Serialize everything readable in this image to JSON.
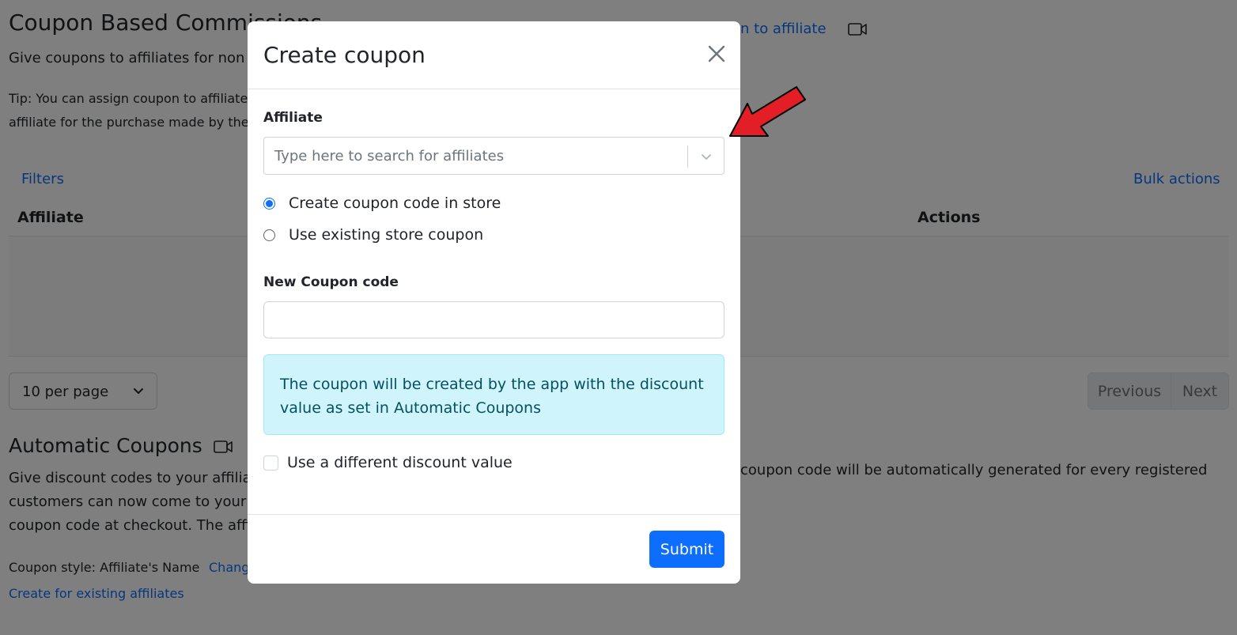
{
  "page": {
    "title": "Coupon Based Commissions",
    "subtitle": "Give coupons to affiliates for non r",
    "assign_link": "n to affiliate",
    "tip_line1": "Tip: You can assign coupon to affiliates.",
    "tip_line2": "affiliate for the purchase made by the c",
    "filters": "Filters",
    "bulk_actions": "Bulk actions",
    "columns": {
      "affiliate": "Affiliate",
      "actions": "Actions"
    },
    "per_page": "10 per page",
    "pager": {
      "previous": "Previous",
      "next": "Next"
    },
    "auto": {
      "title": "Automatic Coupons",
      "desc_line1_left": "Give discount codes to your affiliat",
      "desc_line1_right": "coupon code will be automatically generated for every registered",
      "desc_line2": "customers can now come to your s",
      "desc_line3": "coupon code at checkout. The affil",
      "style_label": "Coupon style: Affiliate's Name",
      "change_link": "Chang",
      "create_existing": "Create for existing affiliates"
    }
  },
  "modal": {
    "title": "Create coupon",
    "affiliate_label": "Affiliate",
    "affiliate_placeholder": "Type here to search for affiliates",
    "radio_create": "Create coupon code in store",
    "radio_existing": "Use existing store coupon",
    "new_code_label": "New Coupon code",
    "new_code_value": "",
    "info": "The coupon will be created by the app with the discount value as set in Automatic Coupons",
    "checkbox_label": "Use a different discount value",
    "submit": "Submit"
  },
  "colors": {
    "primary": "#0d6efd",
    "info_bg": "#cff4fc",
    "arrow": "#e41e26"
  }
}
